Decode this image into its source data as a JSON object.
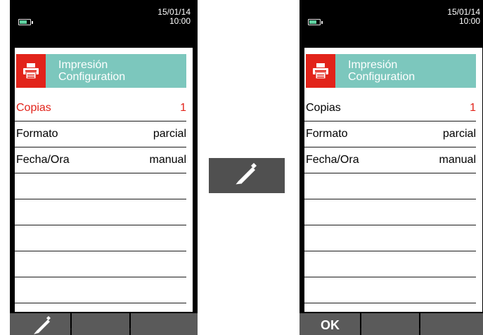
{
  "left": {
    "date": "15/01/14",
    "time": "10:00",
    "header": {
      "line1": "Impresión",
      "line2": "Configuration"
    },
    "rows": [
      {
        "label": "Copias",
        "value": "1"
      },
      {
        "label": "Formato",
        "value": "parcial"
      },
      {
        "label": "Fecha/Ora",
        "value": "manual"
      }
    ],
    "softkey1_icon": "pen-icon"
  },
  "middle": {
    "icon": "pen-icon"
  },
  "right": {
    "date": "15/01/14",
    "time": "10:00",
    "header": {
      "line1": "Impresión",
      "line2": "Configuration"
    },
    "rows": [
      {
        "label": "Copias",
        "value": "1"
      },
      {
        "label": "Formato",
        "value": "parcial"
      },
      {
        "label": "Fecha/Ora",
        "value": "manual"
      }
    ],
    "softkey1_label": "OK"
  },
  "colors": {
    "header": "#7cc7bd",
    "accent_red": "#e2231a",
    "softkey": "#5a5a5a",
    "device": "#000000"
  }
}
